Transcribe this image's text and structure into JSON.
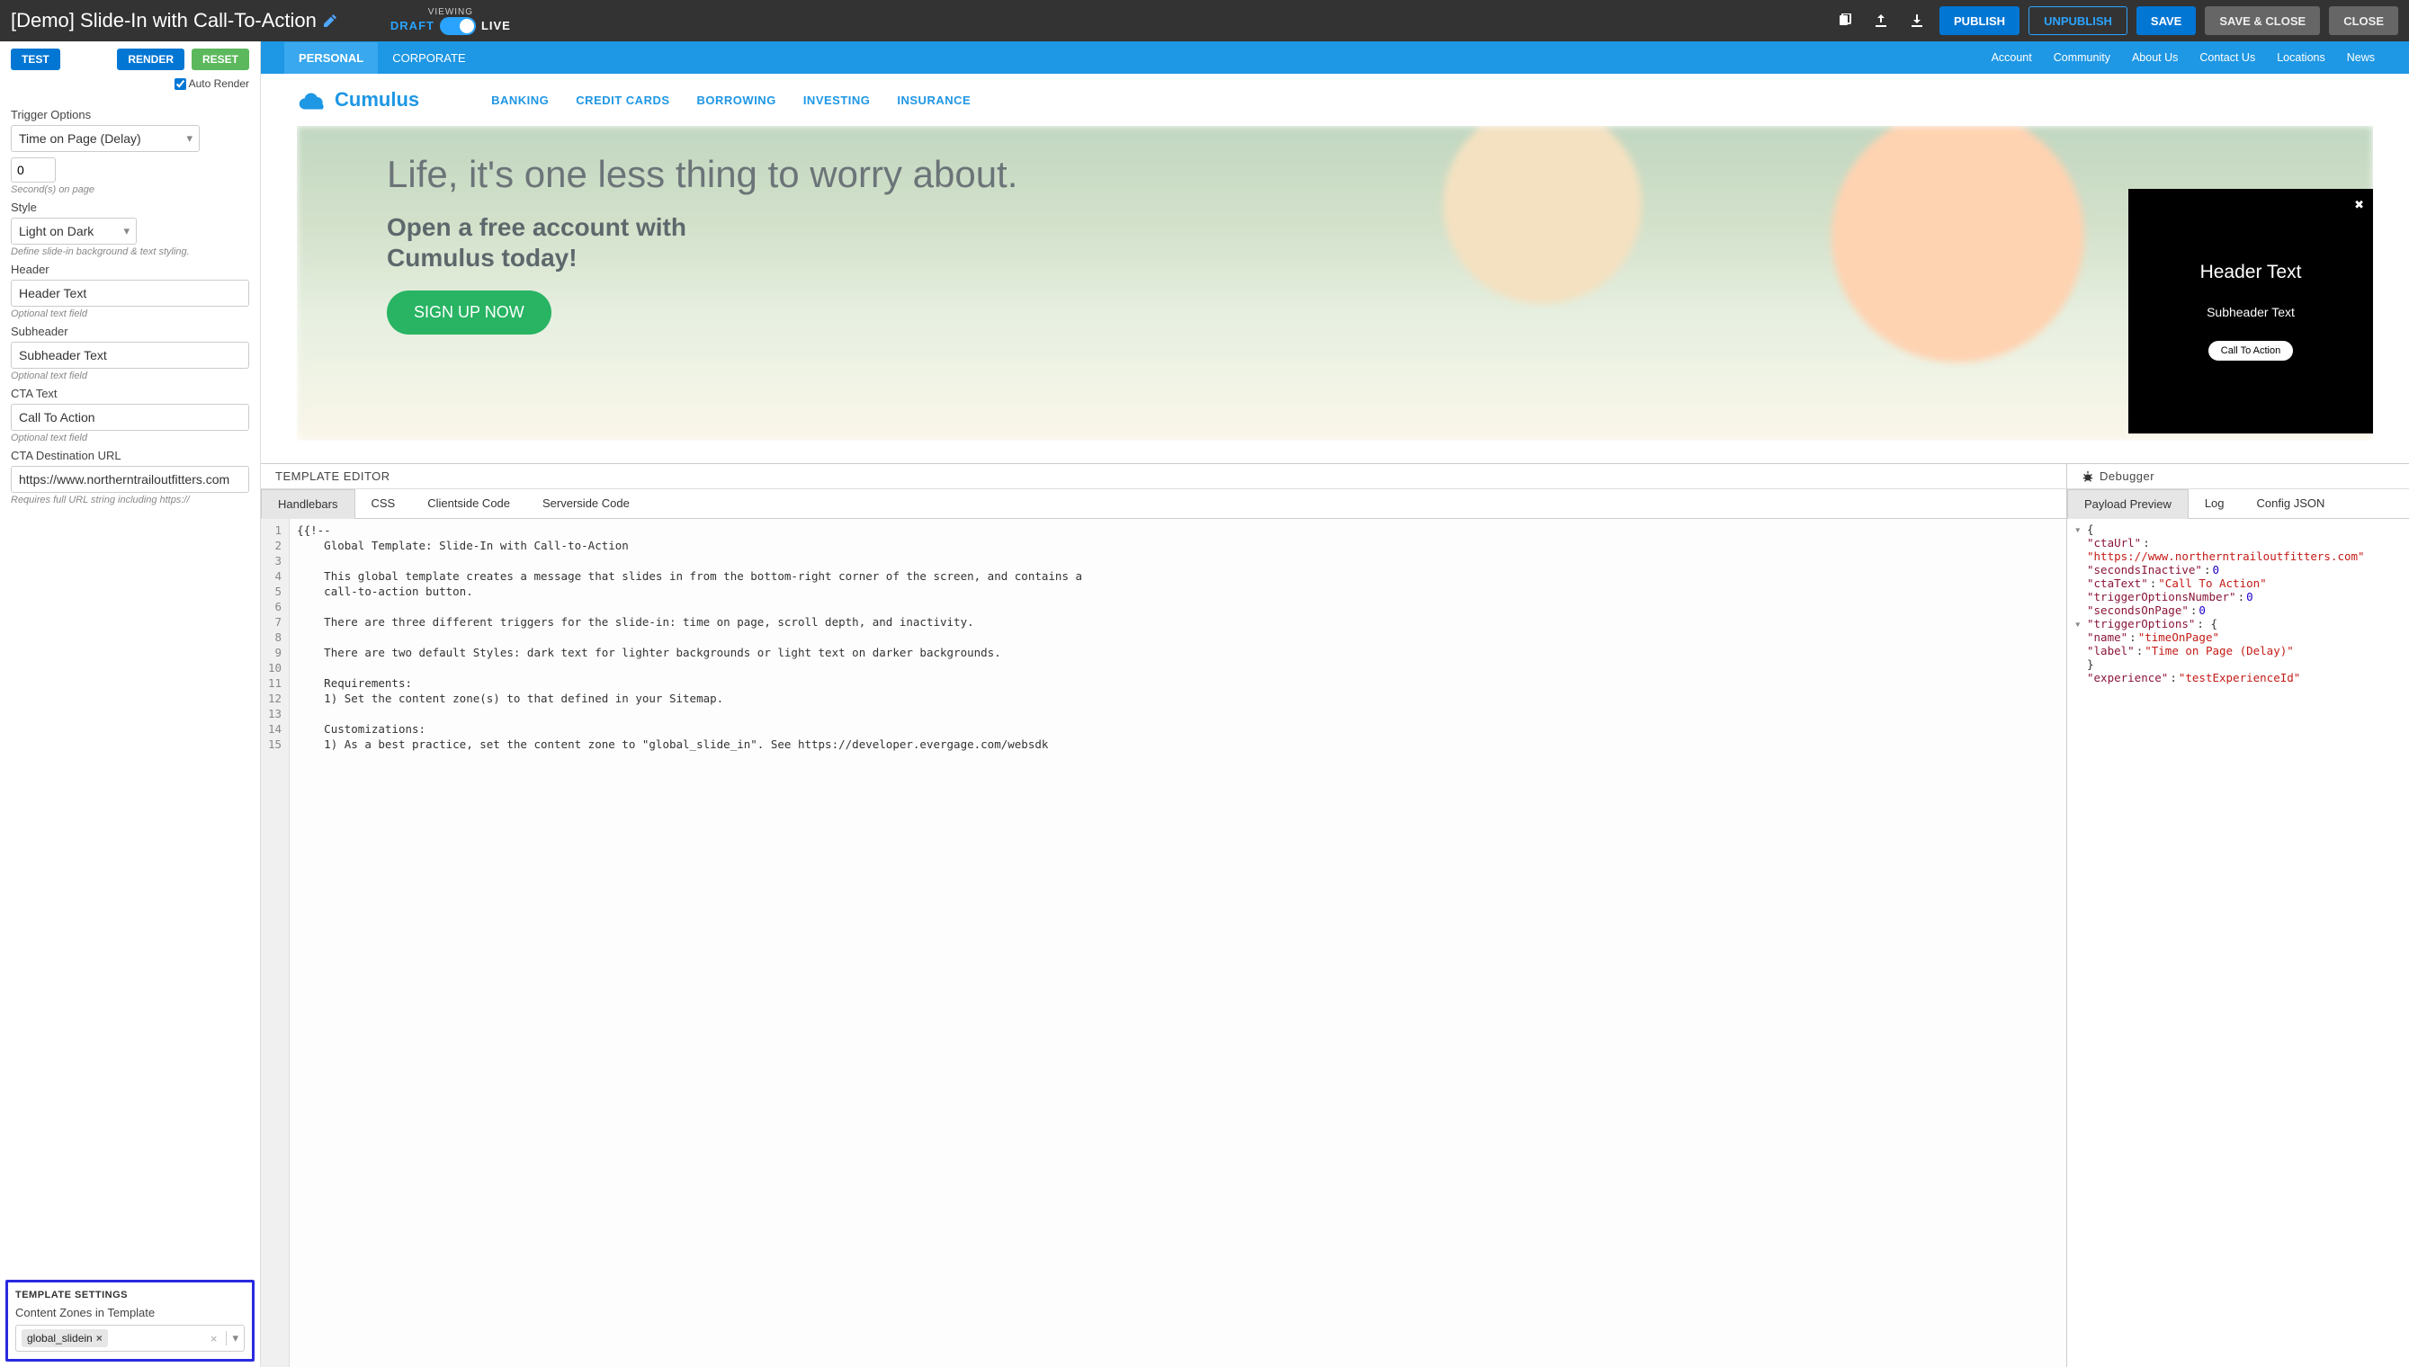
{
  "topbar": {
    "title": "[Demo] Slide-In with Call-To-Action",
    "viewing_label": "VIEWING",
    "draft": "DRAFT",
    "live": "LIVE",
    "publish": "PUBLISH",
    "unpublish": "UNPUBLISH",
    "save": "SAVE",
    "save_close": "SAVE & CLOSE",
    "close": "CLOSE"
  },
  "sidebar": {
    "test": "TEST",
    "render": "RENDER",
    "reset": "RESET",
    "autorender": "Auto Render",
    "trigger_label": "Trigger Options",
    "trigger_value": "Time on Page (Delay)",
    "seconds_value": "0",
    "seconds_help": "Second(s) on page",
    "style_label": "Style",
    "style_value": "Light on Dark",
    "style_help": "Define slide-in background & text styling.",
    "header_label": "Header",
    "header_value": "Header Text",
    "header_help": "Optional text field",
    "subheader_label": "Subheader",
    "subheader_value": "Subheader Text",
    "subheader_help": "Optional text field",
    "cta_label": "CTA Text",
    "cta_value": "Call To Action",
    "cta_help": "Optional text field",
    "ctaurl_label": "CTA Destination URL",
    "ctaurl_value": "https://www.northerntrailoutfitters.com",
    "ctaurl_help": "Requires full URL string including https://",
    "ts_title": "TEMPLATE SETTINGS",
    "ts_label": "Content Zones in Template",
    "ts_chip": "global_slidein"
  },
  "preview": {
    "tabs": {
      "personal": "PERSONAL",
      "corporate": "CORPORATE"
    },
    "links": [
      "Account",
      "Community",
      "About Us",
      "Contact Us",
      "Locations",
      "News"
    ],
    "logo": "Cumulus",
    "nav": [
      "BANKING",
      "CREDIT CARDS",
      "BORROWING",
      "INVESTING",
      "INSURANCE"
    ],
    "hero1": "Life, it's one less thing to worry about.",
    "hero2a": "Open a free account with",
    "hero2b": "Cumulus today!",
    "signup": "SIGN UP NOW",
    "slide_header": "Header Text",
    "slide_sub": "Subheader Text",
    "slide_cta": "Call To Action"
  },
  "template_editor": {
    "title": "TEMPLATE EDITOR",
    "tabs": [
      "Handlebars",
      "CSS",
      "Clientside Code",
      "Serverside Code"
    ],
    "lines": [
      "{{!--",
      "    Global Template: Slide-In with Call-to-Action",
      "",
      "    This global template creates a message that slides in from the bottom-right corner of the screen, and contains a",
      "    call-to-action button.",
      "",
      "    There are three different triggers for the slide-in: time on page, scroll depth, and inactivity.",
      "",
      "    There are two default Styles: dark text for lighter backgrounds or light text on darker backgrounds.",
      "",
      "    Requirements:",
      "    1) Set the content zone(s) to that defined in your Sitemap.",
      "",
      "    Customizations:",
      "    1) As a best practice, set the content zone to \"global_slide_in\". See https://developer.evergage.com/websdk"
    ]
  },
  "debugger": {
    "title": "Debugger",
    "tabs": [
      "Payload Preview",
      "Log",
      "Config JSON"
    ],
    "json": {
      "ctaUrl": "https://www.northerntrailoutfitters.com",
      "secondsInactive": 0,
      "ctaText": "Call To Action",
      "triggerOptionsNumber": 0,
      "secondsOnPage": 0,
      "triggerOptions": {
        "name": "timeOnPage",
        "label": "Time on Page (Delay)"
      },
      "experience_key": "experience",
      "experience_val": "testExperienceId"
    }
  }
}
